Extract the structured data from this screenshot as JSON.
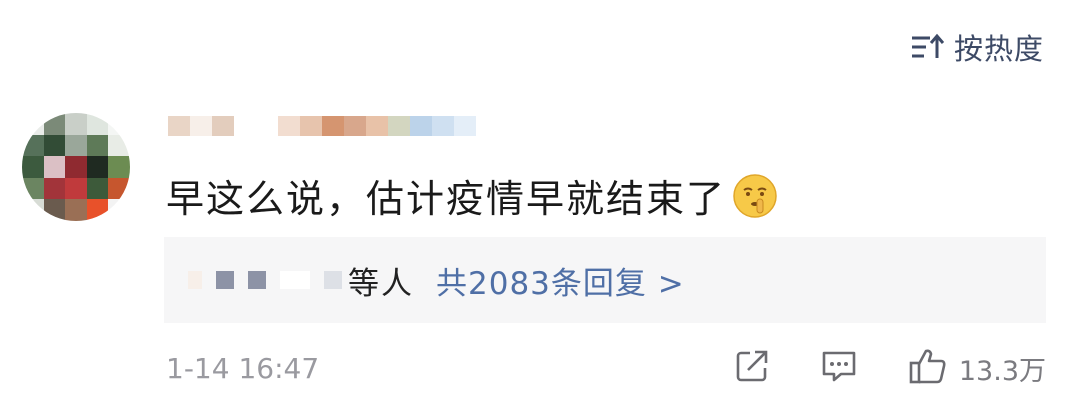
{
  "sort": {
    "label": "按热度"
  },
  "comment": {
    "text": "早这么说，估计疫情早就结束了",
    "emoji": "shush-emoji"
  },
  "replies": {
    "author_suffix": "等人",
    "summary": "共2083条回复 >"
  },
  "meta": {
    "timestamp": "1-14 16:47",
    "like_count": "13.3万"
  },
  "icons": [
    "sort-icon",
    "share-icon",
    "reply-icon",
    "like-icon"
  ],
  "colors": {
    "link": "#4f6fa6",
    "meta_text": "#9a9aa0",
    "reply_bg": "#f6f6f7"
  }
}
